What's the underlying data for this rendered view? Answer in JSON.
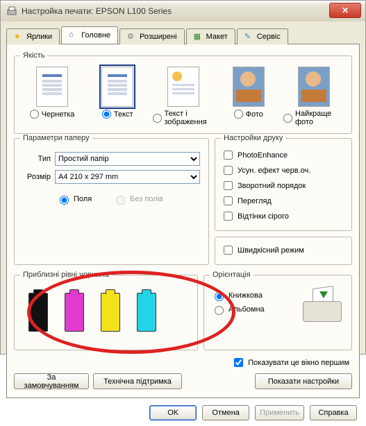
{
  "title": "Настройка печати: EPSON L100 Series",
  "closeGlyph": "✕",
  "tabs": [
    {
      "label": "Ярлики",
      "active": false
    },
    {
      "label": "Головне",
      "active": true
    },
    {
      "label": "Розширені",
      "active": false
    },
    {
      "label": "Макет",
      "active": false
    },
    {
      "label": "Сервіс",
      "active": false
    }
  ],
  "quality": {
    "legend": "Якість",
    "options": [
      {
        "label": "Чернетка",
        "selected": false
      },
      {
        "label": "Текст",
        "selected": true
      },
      {
        "label": "Текст і зображення",
        "selected": false
      },
      {
        "label": "Фото",
        "selected": false
      },
      {
        "label": "Найкраще фото",
        "selected": false
      }
    ]
  },
  "paper": {
    "legend": "Параметри паперу",
    "typeLabel": "Тип",
    "typeValue": "Простий папір",
    "sizeLabel": "Розмір",
    "sizeValue": "A4 210 x 297 mm",
    "margins": {
      "withLabel": "Поля",
      "withoutLabel": "Без полів",
      "selected": "with"
    }
  },
  "printOptions": {
    "legend": "Настройки друку",
    "items": [
      {
        "label": "PhotoEnhance",
        "checked": false
      },
      {
        "label": "Усун. ефект черв.оч.",
        "checked": false
      },
      {
        "label": "Зворотний порядок",
        "checked": false
      },
      {
        "label": "Перегляд",
        "checked": false
      },
      {
        "label": "Відтінки сірого",
        "checked": false
      }
    ],
    "fast": {
      "label": "Швидкісний режим",
      "checked": false
    }
  },
  "ink": {
    "legend": "Приблизні рівні чорнила",
    "levels": [
      "black",
      "magenta",
      "yellow",
      "cyan"
    ]
  },
  "orientation": {
    "legend": "Орієнтація",
    "options": [
      {
        "label": "Книжкова",
        "selected": true
      },
      {
        "label": "Альбомна",
        "selected": false
      }
    ]
  },
  "showFirst": {
    "label": "Показувати це вікно першим",
    "checked": true
  },
  "buttons": {
    "defaults": "За замовчуванням",
    "techSupport": "Технічна підтримка",
    "showSettings": "Показати настройки",
    "ok": "OK",
    "cancel": "Отмена",
    "apply": "Применить",
    "help": "Справка"
  },
  "icons": {
    "star": "★",
    "home": "⌂",
    "gear": "⚙",
    "layout": "▦",
    "wand": "✎"
  }
}
